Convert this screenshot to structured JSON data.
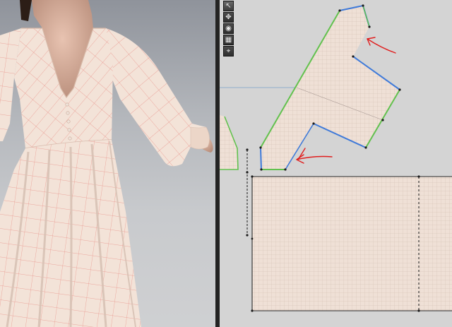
{
  "viewport_3d": {
    "garment": "dress",
    "fabric_color": "#f3e3d8",
    "grid_line_color": "#e7847c",
    "buttons_count": 7
  },
  "pattern_window": {
    "background_color": "#d4d4d4",
    "piece_fill": "#efe0d6",
    "selected_edge_colors": [
      "#3f7ad9",
      "#62c14e"
    ],
    "annotation_color": "#e01e1e",
    "annotation_arrows": 2
  },
  "toolbar": {
    "tools": [
      {
        "name": "select-tool-icon",
        "glyph": "↖"
      },
      {
        "name": "transform-tool-icon",
        "glyph": "✥"
      },
      {
        "name": "simulation-tool-icon",
        "glyph": "◉"
      },
      {
        "name": "texture-tool-icon",
        "glyph": "▦"
      },
      {
        "name": "pin-tool-icon",
        "glyph": "⌖"
      }
    ]
  }
}
